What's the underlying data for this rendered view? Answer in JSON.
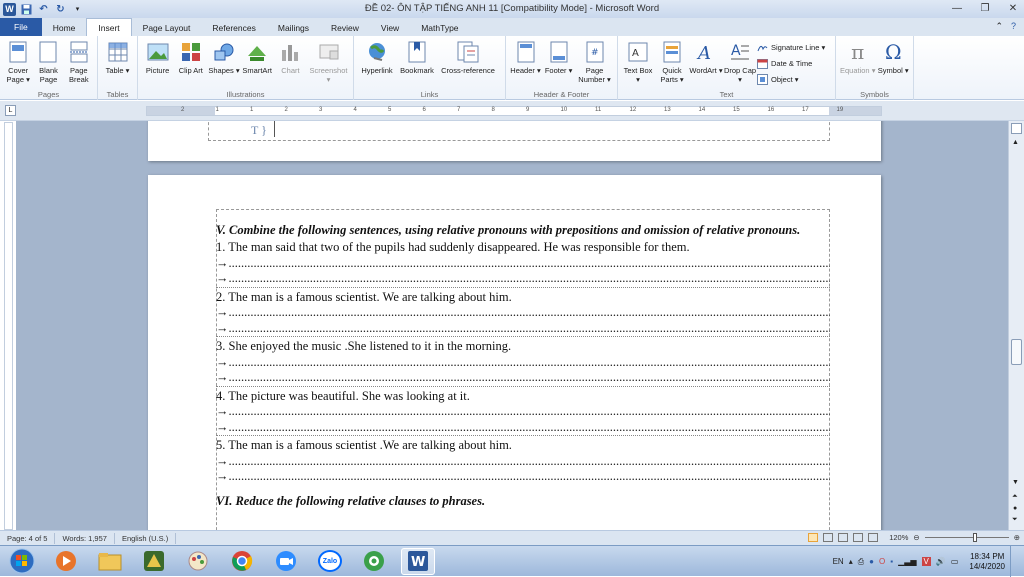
{
  "window": {
    "title": "ĐỀ 02- ÔN TẬP TIẾNG ANH 11 [Compatibility Mode] - Microsoft Word",
    "app_logo": "W"
  },
  "ribbon_tabs": [
    {
      "label": "File"
    },
    {
      "label": "Home"
    },
    {
      "label": "Insert"
    },
    {
      "label": "Page Layout"
    },
    {
      "label": "References"
    },
    {
      "label": "Mailings"
    },
    {
      "label": "Review"
    },
    {
      "label": "View"
    },
    {
      "label": "MathType"
    }
  ],
  "ribbon": {
    "pages": {
      "label": "Pages",
      "cover": "Cover Page ▾",
      "blank": "Blank Page",
      "break": "Page Break"
    },
    "tables": {
      "label": "Tables",
      "table": "Table ▾"
    },
    "illustrations": {
      "label": "Illustrations",
      "picture": "Picture",
      "clipart": "Clip Art",
      "shapes": "Shapes ▾",
      "smartart": "SmartArt",
      "chart": "Chart",
      "screenshot": "Screenshot ▾"
    },
    "links": {
      "label": "Links",
      "hyperlink": "Hyperlink",
      "bookmark": "Bookmark",
      "crossref": "Cross-reference"
    },
    "headerfooter": {
      "label": "Header & Footer",
      "header": "Header ▾",
      "footer": "Footer ▾",
      "pagenumber": "Page Number ▾"
    },
    "text": {
      "label": "Text",
      "textbox": "Text Box ▾",
      "quickparts": "Quick Parts ▾",
      "wordart": "WordArt ▾",
      "dropcap": "Drop Cap ▾",
      "signature": "Signature Line ▾",
      "datetime": "Date & Time",
      "object": "Object ▾"
    },
    "symbols": {
      "label": "Symbols",
      "equation": "Equation ▾",
      "symbol": "Symbol ▾"
    }
  },
  "ruler": {
    "numbers": [
      "2",
      "1",
      "1",
      "2",
      "3",
      "4",
      "5",
      "6",
      "7",
      "8",
      "9",
      "10",
      "11",
      "12",
      "13",
      "14",
      "15",
      "16",
      "17",
      "19"
    ]
  },
  "page1": {
    "text": "T }"
  },
  "document": {
    "heading_v": "V. Combine the following sentences, using relative pronouns with prepositions and omission of relative pronouns.",
    "questions": [
      {
        "text": "1. The man said that two of the pupils had suddenly disappeared. He was responsible for them."
      },
      {
        "text": "2. The man is a famous scientist. We are talking about him."
      },
      {
        "text": "3. She enjoyed the music .She listened to it in the morning."
      },
      {
        "text": "4. The picture was beautiful. She was looking at it."
      },
      {
        "text": "5. The man is a famous scientist .We are talking about him."
      }
    ],
    "arrow": "→",
    "heading_vi": "VI. Reduce the following relative clauses to phrases."
  },
  "status": {
    "page": "Page: 4 of 5",
    "words": "Words: 1,957",
    "language": "English (U.S.)",
    "zoom": "120%"
  },
  "taskbar": {
    "lang": "EN",
    "time": "18:34 PM",
    "date": "14/4/2020",
    "zalo": "Zalo"
  },
  "colors": {
    "file_tab": "#2a5aa6",
    "ribbon_bg": "#eef3fa",
    "doc_bg": "#a4b5cc",
    "taskbar": "#9db8db"
  }
}
